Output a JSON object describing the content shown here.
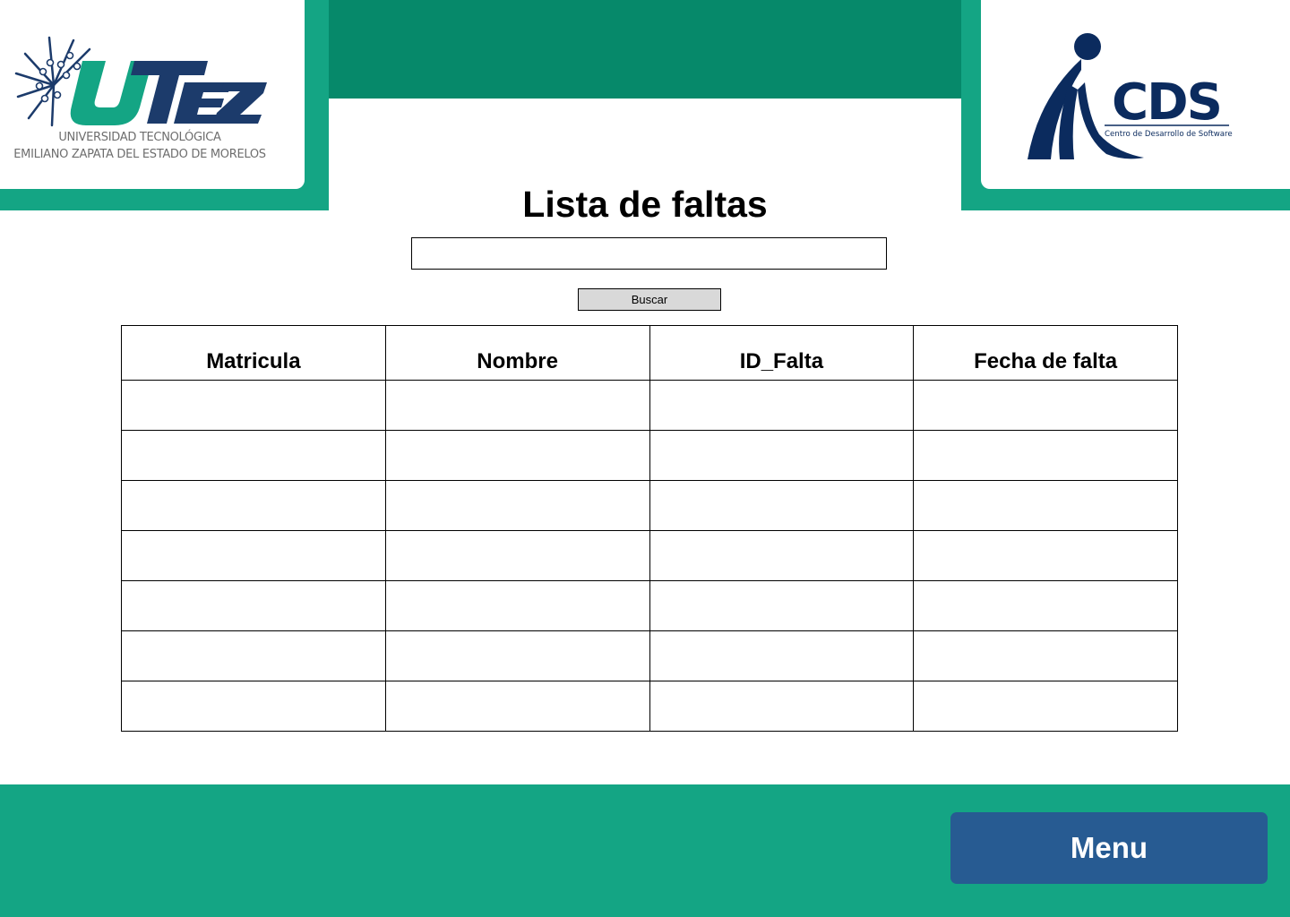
{
  "header": {
    "left_logo": {
      "name": "UTEZ",
      "line1": "UNIVERSIDAD TECNOLÓGICA",
      "line2": "EMILIANO ZAPATA DEL ESTADO DE MORELOS"
    },
    "right_logo": {
      "name": "CDS",
      "tagline": "Centro de Desarrollo de Software"
    }
  },
  "page": {
    "title": "Lista de faltas"
  },
  "search": {
    "value": "",
    "placeholder": "",
    "button_label": "Buscar"
  },
  "table": {
    "columns": [
      "Matricula",
      "Nombre",
      "ID_Falta",
      "Fecha de falta"
    ],
    "rows": [
      [
        "",
        "",
        "",
        ""
      ],
      [
        "",
        "",
        "",
        ""
      ],
      [
        "",
        "",
        "",
        ""
      ],
      [
        "",
        "",
        "",
        ""
      ],
      [
        "",
        "",
        "",
        ""
      ],
      [
        "",
        "",
        "",
        ""
      ],
      [
        "",
        "",
        "",
        ""
      ]
    ]
  },
  "footer": {
    "menu_label": "Menu"
  },
  "colors": {
    "header_band": "#06896a",
    "accent_green": "#14a584",
    "menu_button": "#275b92",
    "utez_navy": "#1c3b6b",
    "cds_navy": "#0b2b5e"
  }
}
